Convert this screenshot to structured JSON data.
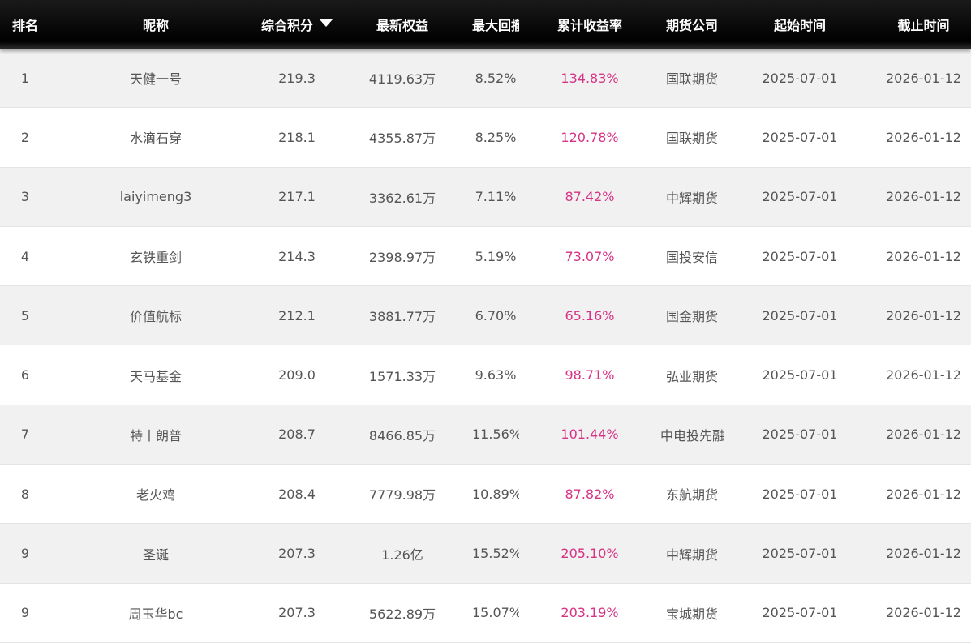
{
  "columns": {
    "rank": "排名",
    "name": "昵称",
    "score": "综合积分",
    "equity": "最新权益",
    "drawdown": "最大回撤",
    "return": "累计收益率",
    "broker": "期货公司",
    "start": "起始时间",
    "end": "截止时间"
  },
  "sort_icon": "sort-desc-icon",
  "colors": {
    "header_bg": "#000000",
    "return_text": "#d63384",
    "row_alt_bg": "#f1f1f1"
  },
  "rows": [
    {
      "rank": "1",
      "name": "天健一号",
      "score": "219.3",
      "equity": "4119.63万",
      "drawdown": "8.52%",
      "return": "134.83%",
      "broker": "国联期货",
      "start": "2025-07-01",
      "end": "2026-01-12"
    },
    {
      "rank": "2",
      "name": "水滴石穿",
      "score": "218.1",
      "equity": "4355.87万",
      "drawdown": "8.25%",
      "return": "120.78%",
      "broker": "国联期货",
      "start": "2025-07-01",
      "end": "2026-01-12"
    },
    {
      "rank": "3",
      "name": "laiyimeng3",
      "score": "217.1",
      "equity": "3362.61万",
      "drawdown": "7.11%",
      "return": "87.42%",
      "broker": "中辉期货",
      "start": "2025-07-01",
      "end": "2026-01-12"
    },
    {
      "rank": "4",
      "name": "玄铁重剑",
      "score": "214.3",
      "equity": "2398.97万",
      "drawdown": "5.19%",
      "return": "73.07%",
      "broker": "国投安信",
      "start": "2025-07-01",
      "end": "2026-01-12"
    },
    {
      "rank": "5",
      "name": "价值航标",
      "score": "212.1",
      "equity": "3881.77万",
      "drawdown": "6.70%",
      "return": "65.16%",
      "broker": "国金期货",
      "start": "2025-07-01",
      "end": "2026-01-12"
    },
    {
      "rank": "6",
      "name": "天马基金",
      "score": "209.0",
      "equity": "1571.33万",
      "drawdown": "9.63%",
      "return": "98.71%",
      "broker": "弘业期货",
      "start": "2025-07-01",
      "end": "2026-01-12"
    },
    {
      "rank": "7",
      "name": "特丨朗普",
      "score": "208.7",
      "equity": "8466.85万",
      "drawdown": "11.56%",
      "return": "101.44%",
      "broker": "中电投先融",
      "start": "2025-07-01",
      "end": "2026-01-12"
    },
    {
      "rank": "8",
      "name": "老火鸡",
      "score": "208.4",
      "equity": "7779.98万",
      "drawdown": "10.89%",
      "return": "87.82%",
      "broker": "东航期货",
      "start": "2025-07-01",
      "end": "2026-01-12"
    },
    {
      "rank": "9",
      "name": "圣诞",
      "score": "207.3",
      "equity": "1.26亿",
      "drawdown": "15.52%",
      "return": "205.10%",
      "broker": "中辉期货",
      "start": "2025-07-01",
      "end": "2026-01-12"
    },
    {
      "rank": "9",
      "name": "周玉华bc",
      "score": "207.3",
      "equity": "5622.89万",
      "drawdown": "15.07%",
      "return": "203.19%",
      "broker": "宝城期货",
      "start": "2025-07-01",
      "end": "2026-01-12"
    }
  ]
}
